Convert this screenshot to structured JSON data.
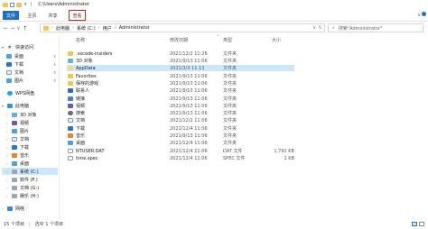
{
  "window": {
    "title": "C:\\Users\\Administrator"
  },
  "quick_access": {
    "separator": "|",
    "customize_arrow": "▾"
  },
  "ribbon": {
    "tabs": [
      {
        "label": "文件"
      },
      {
        "label": "主页"
      },
      {
        "label": "共享"
      },
      {
        "label": "查看"
      }
    ],
    "collapse_arrow": "∨",
    "help_icon": "help-icon"
  },
  "navigation": {
    "back": "←",
    "forward": "→",
    "recent": "∨",
    "up": "↑"
  },
  "address": {
    "crumbs": [
      "此电脑",
      "系统 (C:)",
      "用户",
      "Administrator"
    ],
    "separator": "›",
    "dropdown": "∨",
    "refresh": "↻"
  },
  "search": {
    "icon": "⌕",
    "placeholder": "搜索\"Administrator\""
  },
  "nav_pane": {
    "items": [
      {
        "label": "快速访问",
        "icon": "star"
      },
      {
        "label": "桌面",
        "icon": "desktop"
      },
      {
        "label": "下载",
        "icon": "download"
      },
      {
        "label": "文档",
        "icon": "document"
      },
      {
        "label": "图片",
        "icon": "picture"
      },
      {
        "label": "WPS网盘",
        "icon": "cloud"
      },
      {
        "label": "此电脑",
        "icon": "computer"
      },
      {
        "label": "3D 对象",
        "icon": "3d"
      },
      {
        "label": "视频",
        "icon": "video"
      },
      {
        "label": "图片",
        "icon": "picture"
      },
      {
        "label": "文档",
        "icon": "document"
      },
      {
        "label": "下载",
        "icon": "download"
      },
      {
        "label": "音乐",
        "icon": "music"
      },
      {
        "label": "桌面",
        "icon": "desktop"
      },
      {
        "label": "系统 (C:)",
        "icon": "drive"
      },
      {
        "label": "软件 (F:)",
        "icon": "drive"
      },
      {
        "label": "文档 (G:)",
        "icon": "drive"
      },
      {
        "label": "娱乐 (H:)",
        "icon": "drive"
      },
      {
        "label": "网络",
        "icon": "network"
      }
    ]
  },
  "columns": {
    "name": "名称",
    "date": "修改日期",
    "type": "类型",
    "size": "大小",
    "sort_indicator": "^"
  },
  "files": [
    {
      "name": ".vscode-insiders",
      "date": "2021/12/2 11:26",
      "type": "文件夹",
      "size": "",
      "icon": "folder"
    },
    {
      "name": "3D 对象",
      "date": "2021/9/13 11:06",
      "type": "文件夹",
      "size": "",
      "icon": "3d"
    },
    {
      "name": "AppData",
      "date": "2021/3/3 11:13",
      "type": "文件夹",
      "size": "",
      "icon": "folder-hidden"
    },
    {
      "name": "Favorites",
      "date": "2021/9/13 11:06",
      "type": "文件夹",
      "size": "",
      "icon": "folder"
    },
    {
      "name": "保存的游戏",
      "date": "2021/9/13 11:06",
      "type": "文件夹",
      "size": "",
      "icon": "games"
    },
    {
      "name": "联系人",
      "date": "2021/9/13 11:06",
      "type": "文件夹",
      "size": "",
      "icon": "contacts"
    },
    {
      "name": "链接",
      "date": "2021/9/13 11:06",
      "type": "文件夹",
      "size": "",
      "icon": "links"
    },
    {
      "name": "视频",
      "date": "2021/9/13 11:06",
      "type": "文件夹",
      "size": "",
      "icon": "video"
    },
    {
      "name": "搜索",
      "date": "2021/9/13 11:06",
      "type": "文件夹",
      "size": "",
      "icon": "search"
    },
    {
      "name": "文档",
      "date": "2021/12/2 11:06",
      "type": "文件夹",
      "size": "",
      "icon": "document"
    },
    {
      "name": "下载",
      "date": "2021/12/4 11:06",
      "type": "文件夹",
      "size": "",
      "icon": "download"
    },
    {
      "name": "音乐",
      "date": "2021/9/13 11:06",
      "type": "文件夹",
      "size": "",
      "icon": "music"
    },
    {
      "name": "桌面",
      "date": "2021/12/4 11:06",
      "type": "文件夹",
      "size": "",
      "icon": "desktop"
    },
    {
      "name": "NTUSER.DAT",
      "date": "2021/12/4 11:06",
      "type": "DAT 文件",
      "size": "1,792 KB",
      "icon": "file"
    },
    {
      "name": "time.spec",
      "date": "2021/12/4 11:06",
      "type": "SPEC 文件",
      "size": "1 KB",
      "icon": "file"
    }
  ],
  "status": {
    "item_count": "15 个项目",
    "selected": "选中 1 个项目"
  },
  "colors": {
    "accent": "#1f6fc6",
    "selection": "#cce8ff",
    "highlight_box": "#d81e1e",
    "folder": "#f2c450"
  }
}
